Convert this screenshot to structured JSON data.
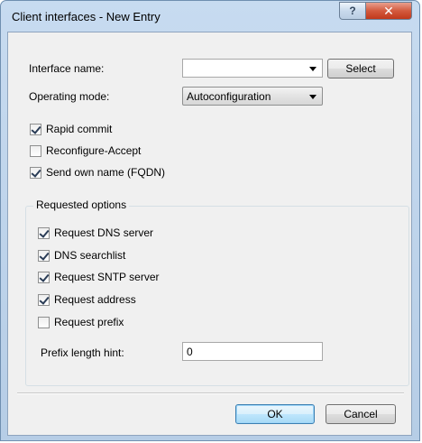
{
  "window": {
    "title": "Client interfaces - New Entry"
  },
  "titlebar": {
    "help_icon": "?",
    "close_icon": "✕"
  },
  "interface_name": {
    "label": "Interface name:",
    "value": "",
    "select_button": "Select"
  },
  "operating_mode": {
    "label": "Operating mode:",
    "value": "Autoconfiguration"
  },
  "checkboxes": [
    {
      "label": "Rapid commit",
      "checked": true
    },
    {
      "label": "Reconfigure-Accept",
      "checked": false
    },
    {
      "label": "Send own name (FQDN)",
      "checked": true
    }
  ],
  "requested_options": {
    "title": "Requested options",
    "items": [
      {
        "label": "Request DNS server",
        "checked": true
      },
      {
        "label": "DNS searchlist",
        "checked": true
      },
      {
        "label": "Request SNTP server",
        "checked": true
      },
      {
        "label": "Request address",
        "checked": true
      },
      {
        "label": "Request prefix",
        "checked": false
      }
    ],
    "prefix_hint_label": "Prefix length hint:",
    "prefix_hint_value": "0"
  },
  "buttons": {
    "ok": "OK",
    "cancel": "Cancel"
  }
}
